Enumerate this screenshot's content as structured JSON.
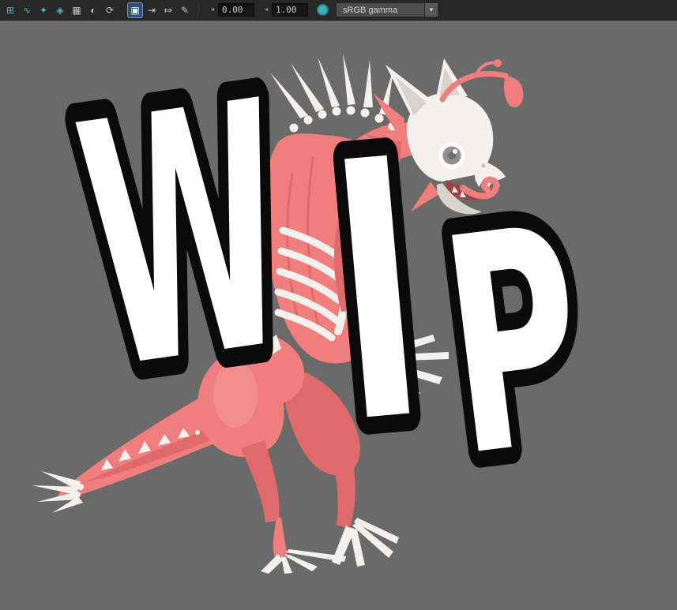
{
  "toolbar": {
    "icons_left": [
      {
        "label": "snap-to-grids",
        "glyph": "⊞"
      },
      {
        "label": "snap-to-curves",
        "glyph": "∿"
      },
      {
        "label": "snap-to-points",
        "glyph": "✦"
      },
      {
        "label": "snap-to-projected-center",
        "glyph": "◈"
      },
      {
        "label": "make-live",
        "glyph": "▦"
      },
      {
        "label": "symmetry",
        "glyph": "◐"
      },
      {
        "label": "construction-history",
        "glyph": "⟳"
      }
    ],
    "icons_mid": [
      {
        "label": "isolate-select",
        "glyph": "▣",
        "selected": true
      },
      {
        "label": "input-connections",
        "glyph": "⇥"
      },
      {
        "label": "output-connections",
        "glyph": "⤇"
      },
      {
        "label": "paint-effects",
        "glyph": "✎"
      }
    ],
    "exposure": {
      "value": "0.00",
      "slider_glyph": "◄"
    },
    "contrast": {
      "value": "1.00",
      "slider_glyph": "◄"
    },
    "color_management": {
      "selected": "sRGB gamma",
      "arrow_glyph": "▾"
    }
  },
  "viewport": {
    "wip": {
      "text": "WIP",
      "letters": [
        "W",
        "I",
        "P"
      ]
    },
    "model": {
      "description": "skeletal creature with exposed muscles, fish-skull head, angler lure antenna, dorsal spines, rib cage, skeletal hands and long tail",
      "muscle_color": "#ef7e7c",
      "muscle_dark": "#df6a69",
      "muscle_light": "#f7a09c",
      "bone_color": "#f3f1ee",
      "bone_shade": "#d8d3cc",
      "background": "#6a6a6a",
      "wip_fill": "#ffffff",
      "wip_outline": "#0a0a0a"
    }
  }
}
